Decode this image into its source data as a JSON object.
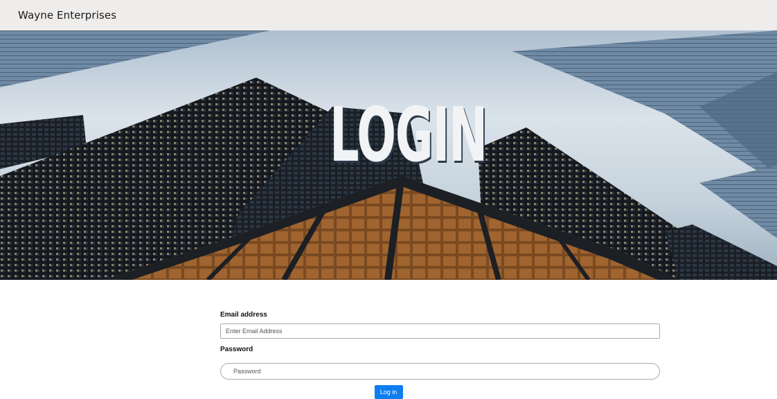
{
  "navbar": {
    "brand": "Wayne Enterprises"
  },
  "hero": {
    "title": "LOGIN"
  },
  "form": {
    "email_label": "Email address",
    "email_placeholder": "Enter Email Address",
    "email_value": "",
    "password_label": "Password",
    "password_placeholder": "Password",
    "password_value": "",
    "submit_label": "Log in"
  },
  "colors": {
    "navbar_bg": "#efedec",
    "button_bg": "#0d7ef0"
  }
}
